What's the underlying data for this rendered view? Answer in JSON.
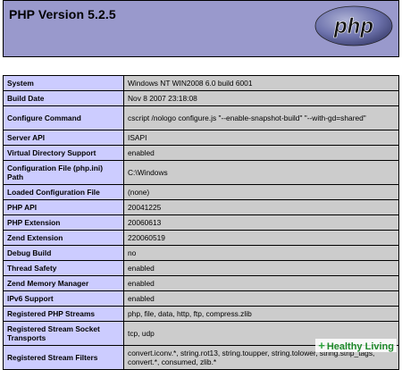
{
  "header": {
    "title": "PHP Version 5.2.5",
    "logo_text": "php"
  },
  "rows": [
    {
      "key": "System",
      "value": "Windows NT WIN2008 6.0 build 6001"
    },
    {
      "key": "Build Date",
      "value": "Nov 8 2007 23:18:08"
    },
    {
      "key": "Configure Command",
      "value": "cscript /nologo configure.js \"--enable-snapshot-build\" \"--with-gd=shared\""
    },
    {
      "key": "Server API",
      "value": "ISAPI"
    },
    {
      "key": "Virtual Directory Support",
      "value": "enabled"
    },
    {
      "key": "Configuration File (php.ini) Path",
      "value": "C:\\Windows"
    },
    {
      "key": "Loaded Configuration File",
      "value": "(none)"
    },
    {
      "key": "PHP API",
      "value": "20041225"
    },
    {
      "key": "PHP Extension",
      "value": "20060613"
    },
    {
      "key": "Zend Extension",
      "value": "220060519"
    },
    {
      "key": "Debug Build",
      "value": "no"
    },
    {
      "key": "Thread Safety",
      "value": "enabled"
    },
    {
      "key": "Zend Memory Manager",
      "value": "enabled"
    },
    {
      "key": "IPv6 Support",
      "value": "enabled"
    },
    {
      "key": "Registered PHP Streams",
      "value": "php, file, data, http, ftp, compress.zlib"
    },
    {
      "key": "Registered Stream Socket Transports",
      "value": "tcp, udp"
    },
    {
      "key": "Registered Stream Filters",
      "value": "convert.iconv.*, string.rot13, string.toupper, string.tolower, string.strip_tags, convert.*, consumed, zlib.*"
    }
  ],
  "watermark": {
    "plus": "+",
    "text": "Healthy Living"
  },
  "colors": {
    "header_bg": "#9999cc",
    "key_bg": "#ccccff",
    "value_bg": "#cccccc"
  }
}
